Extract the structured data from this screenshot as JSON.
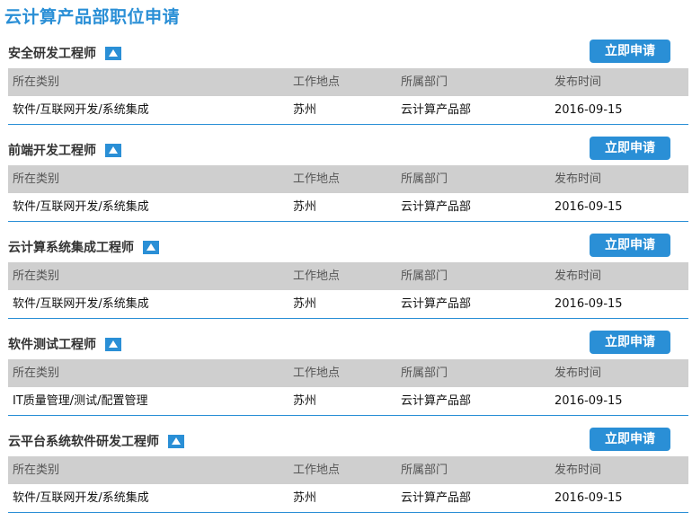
{
  "page_title": "云计算产品部职位申请",
  "columns": [
    "所在类别",
    "工作地点",
    "所属部门",
    "发布时间"
  ],
  "apply_label": "立即申请",
  "jobs": [
    {
      "title": "安全研发工程师",
      "category": "软件/互联网开发/系统集成",
      "location": "苏州",
      "department": "云计算产品部",
      "date": "2016-09-15"
    },
    {
      "title": "前端开发工程师",
      "category": "软件/互联网开发/系统集成",
      "location": "苏州",
      "department": "云计算产品部",
      "date": "2016-09-15"
    },
    {
      "title": "云计算系统集成工程师",
      "category": "软件/互联网开发/系统集成",
      "location": "苏州",
      "department": "云计算产品部",
      "date": "2016-09-15"
    },
    {
      "title": "软件测试工程师",
      "category": "IT质量管理/测试/配置管理",
      "location": "苏州",
      "department": "云计算产品部",
      "date": "2016-09-15"
    },
    {
      "title": "云平台系统软件研发工程师",
      "category": "软件/互联网开发/系统集成",
      "location": "苏州",
      "department": "云计算产品部",
      "date": "2016-09-15"
    }
  ],
  "colors": {
    "accent": "#2a8fd6",
    "header_bg": "#cfcfcf"
  }
}
